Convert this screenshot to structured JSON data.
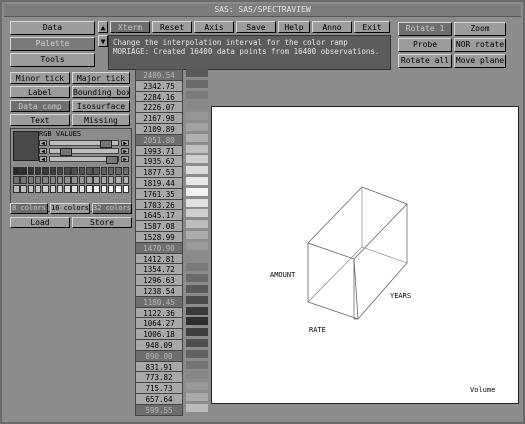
{
  "window_title": "SAS: SAS/SPECTRAVIEW",
  "left_tabs": [
    "Data",
    "Palette",
    "Tools"
  ],
  "menu": [
    "Xterm",
    "Reset",
    "Axis",
    "Save",
    "Help",
    "Anno",
    "Exit"
  ],
  "right_top": [
    "Rotate 1",
    "Zoom"
  ],
  "right_mid": [
    "Probe",
    "NOR rotate"
  ],
  "right_bot": [
    "Rotate all",
    "Move plane"
  ],
  "message_lines": [
    "Change the interpolation interval for the color ramp",
    "MORIAGE: Created 16400 data points from 16400 observations."
  ],
  "tool_buttons": [
    [
      "Minor tick",
      "Major tick"
    ],
    [
      "Label",
      "Bounding box"
    ],
    [
      "Data comp",
      "Isosurface"
    ],
    [
      "Text",
      "Missing"
    ]
  ],
  "rgb_title": "RGB VALUES",
  "colors_buttons": [
    "8 colors",
    "16 colors",
    "32 colors"
  ],
  "load_store": [
    "Load",
    "Store"
  ],
  "legend_values": [
    "2400.54",
    "2342.75",
    "2284.16",
    "2226.07",
    "2167.98",
    "2109.89",
    "2051.80",
    "1993.71",
    "1935.62",
    "1877.53",
    "1819.44",
    "1761.35",
    "1703.26",
    "1645.17",
    "1587.08",
    "1528.99",
    "1470.90",
    "1412.81",
    "1354.72",
    "1296.63",
    "1238.54",
    "1180.45",
    "1122.36",
    "1064.27",
    "1006.18",
    "948.09",
    "890.00",
    "831.91",
    "773.82",
    "715.73",
    "657.64",
    "599.55"
  ],
  "legend_selected": [
    0,
    6,
    16,
    21,
    26,
    31
  ],
  "plot_labels": {
    "amount": "AMOUNT",
    "years": "YEARS",
    "rate": "RATE",
    "volume": "Volume"
  }
}
